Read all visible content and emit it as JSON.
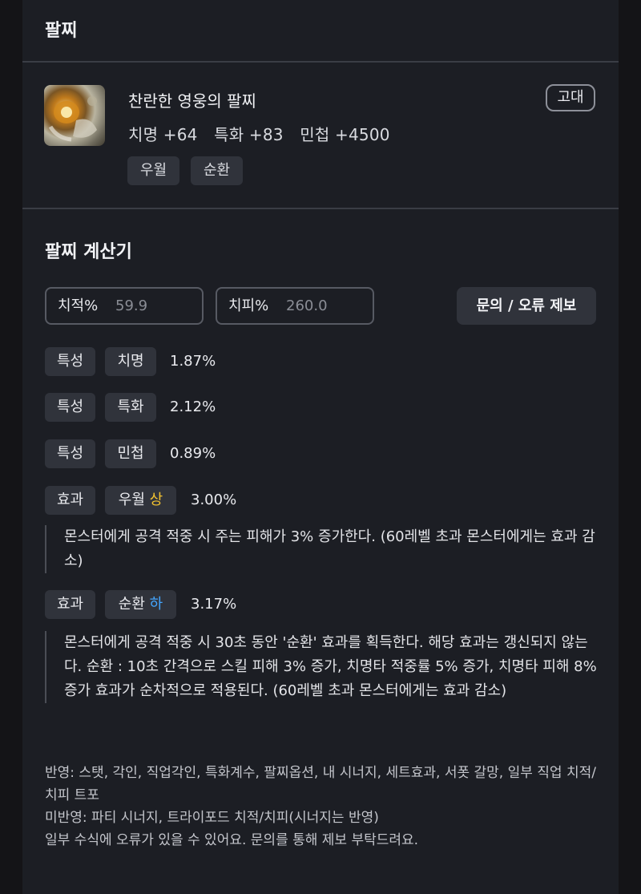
{
  "bracelet_section": {
    "title": "팔찌"
  },
  "item": {
    "name": "찬란한 영웅의 팔찌",
    "icon": "bracelet-item-icon",
    "grade": "고대",
    "stats": [
      "치명 +64",
      "특화 +83",
      "민첩 +4500"
    ],
    "tags": [
      "우월",
      "순환"
    ]
  },
  "calculator": {
    "title": "팔찌 계산기",
    "crit_rate": {
      "label": "치적%",
      "value": "59.9"
    },
    "crit_damage": {
      "label": "치피%",
      "value": "260.0"
    },
    "report_button": "문의 / 오류 제보",
    "rows": [
      {
        "type": "특성",
        "name": "치명",
        "percent": "1.87%"
      },
      {
        "type": "특성",
        "name": "특화",
        "percent": "2.12%"
      },
      {
        "type": "특성",
        "name": "민첩",
        "percent": "0.89%"
      },
      {
        "type": "효과",
        "name": "우월",
        "grade": "상",
        "grade_color": "#f2c230",
        "percent": "3.00%",
        "description": "몬스터에게 공격 적중 시 주는 피해가 3% 증가한다. (60레벨 초과 몬스터에게는 효과 감소)"
      },
      {
        "type": "효과",
        "name": "순환",
        "grade": "하",
        "grade_color": "#44a6ff",
        "percent": "3.17%",
        "description": "몬스터에게 공격 적중 시 30초 동안 '순환' 효과를 획득한다. 해당 효과는 갱신되지 않는다. 순환 : 10초 간격으로 스킬 피해 3% 증가, 치명타 적중률 5% 증가, 치명타 피해 8% 증가 효과가 순차적으로 적용된다. (60레벨 초과 몬스터에게는 효과 감소)"
      }
    ],
    "notes": [
      "반영: 스탯, 각인, 직업각인, 특화계수, 팔찌옵션, 내 시너지, 세트효과, 서폿 갈망, 일부 직업 치적/치피 트포",
      "미반영: 파티 시너지, 트라이포드 치적/치피(시너지는 반영)",
      "일부 수식에 오류가 있을 수 있어요. 문의를 통해 제보 부탁드려요."
    ]
  }
}
